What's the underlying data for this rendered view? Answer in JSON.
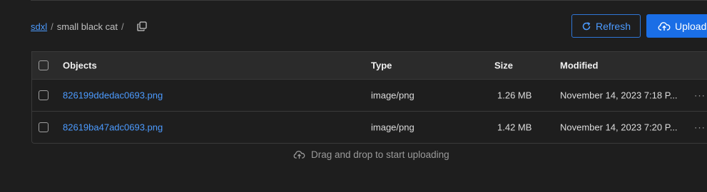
{
  "breadcrumb": {
    "root": "sdxl",
    "separator": "/",
    "folder": "small black cat",
    "trailing_separator": "/"
  },
  "toolbar": {
    "refresh_label": "Refresh",
    "upload_label": "Upload"
  },
  "table": {
    "columns": [
      "Objects",
      "Type",
      "Size",
      "Modified"
    ],
    "rows": [
      {
        "name": "826199ddedac0693.png",
        "type": "image/png",
        "size": "1.26 MB",
        "modified": "November 14, 2023 7:18 P..."
      },
      {
        "name": "82619ba47adc0693.png",
        "type": "image/png",
        "size": "1.42 MB",
        "modified": "November 14, 2023 7:20 P..."
      }
    ],
    "more_glyph": "···"
  },
  "dropzone": {
    "text": "Drag and drop to start uploading"
  },
  "icons": {
    "copy": "copy-icon",
    "refresh": "refresh-icon",
    "upload": "cloud-upload-icon",
    "more": "more-horizontal-icon"
  },
  "colors": {
    "accent": "#1a6ee6",
    "link": "#4c9bff",
    "background": "#1e1e1e",
    "header_bg": "#2b2b2b",
    "border": "#3a3a3a"
  }
}
